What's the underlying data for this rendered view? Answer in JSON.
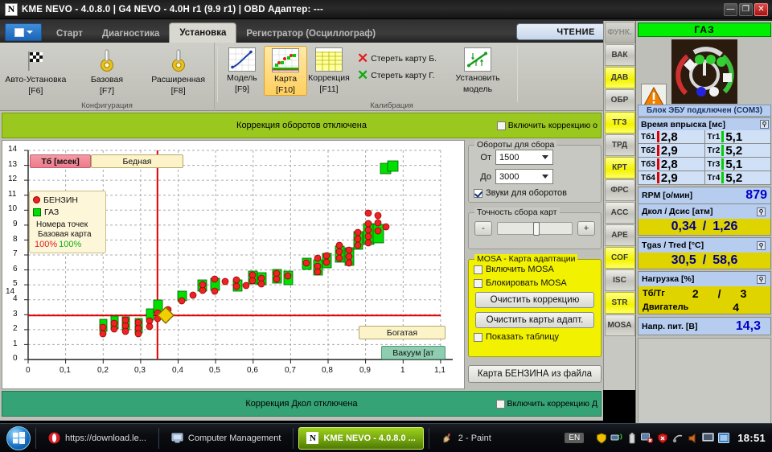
{
  "window": {
    "title": "KME NEVO - 4.0.8.0  |  G4 NEVO - 4.0H r1 (9.9 r1)  |  OBD Адаптер: ---",
    "icon_letter": "N",
    "minimize": "—",
    "maximize": "❐",
    "close": "✕"
  },
  "tabs": [
    {
      "label": "Старт",
      "active": false
    },
    {
      "label": "Диагностика",
      "active": false
    },
    {
      "label": "Установка",
      "active": true
    },
    {
      "label": "Регистратор (Осциллограф)",
      "active": false
    }
  ],
  "read_button": "ЧТЕНИЕ",
  "ribbon": {
    "groups": [
      {
        "label": "Конфигурация",
        "items": [
          {
            "name": "auto-setup",
            "line1": "Авто-Установка",
            "line2": "[F6]",
            "icon": "checkered-flag-icon",
            "selected": false
          },
          {
            "name": "basic",
            "line1": "Базовая",
            "line2": "[F7]",
            "icon": "gear-pin-icon",
            "selected": false
          },
          {
            "name": "advanced",
            "line1": "Расширенная",
            "line2": "[F8]",
            "icon": "gear-pin-icon",
            "selected": false
          }
        ]
      },
      {
        "label": "Калибрация",
        "items": [
          {
            "name": "model",
            "line1": "Модель",
            "line2": "[F9]",
            "icon": "curve-chart-icon",
            "selected": false
          },
          {
            "name": "map",
            "line1": "Карта",
            "line2": "[F10]",
            "icon": "scatter-map-icon",
            "selected": true
          },
          {
            "name": "correction",
            "line1": "Коррекция",
            "line2": "[F11]",
            "icon": "table-grid-icon",
            "selected": false
          }
        ],
        "erase": [
          {
            "label": "Стереть карту Б.",
            "color": "#e02020"
          },
          {
            "label": "Стереть карту Г.",
            "color": "#12aa12"
          }
        ],
        "set_model": {
          "line1": "Установить",
          "line2": "модель",
          "icon": "set-model-icon"
        }
      }
    ]
  },
  "vertical_tabs": [
    {
      "label": "ФУНК.",
      "state": "dim"
    },
    {
      "label": "ВАК",
      "state": "normal"
    },
    {
      "label": "ДАВ",
      "state": "hot"
    },
    {
      "label": "ОБР",
      "state": "normal"
    },
    {
      "label": "ТГЗ",
      "state": "hot"
    },
    {
      "label": "ТРД",
      "state": "normal"
    },
    {
      "label": "КРТ",
      "state": "hot"
    },
    {
      "label": "ФРС",
      "state": "normal"
    },
    {
      "label": "ACC",
      "state": "normal"
    },
    {
      "label": "APE",
      "state": "normal"
    },
    {
      "label": "COF",
      "state": "hot"
    },
    {
      "label": "ISC",
      "state": "normal"
    },
    {
      "label": "STR",
      "state": "hot"
    },
    {
      "label": "MOSA",
      "state": "normal"
    }
  ],
  "right_panel": {
    "fuel_tag": "ГАЗ",
    "connection": "Блок ЭБУ подключен (COM3)",
    "injection": {
      "title": "Время впрыска [мс]",
      "pin": "⚲",
      "rows": [
        {
          "pl": "Тб1",
          "pv": "2,8",
          "gl": "Tг1",
          "gv": "5,1"
        },
        {
          "pl": "Тб2",
          "pv": "2,9",
          "gl": "Tг2",
          "gv": "5,2"
        },
        {
          "pl": "Тб3",
          "pv": "2,8",
          "gl": "Tг3",
          "gv": "5,1"
        },
        {
          "pl": "Тб4",
          "pv": "2,9",
          "gl": "Tг4",
          "gv": "5,2"
        }
      ]
    },
    "rpm": {
      "label": "RPM [о/мин]",
      "value": "879"
    },
    "pressure": {
      "label": "Дкол / Дсис [атм]",
      "v1": "0,34",
      "sep": "/",
      "v2": "1,26",
      "pin": "⚲"
    },
    "temps": {
      "label": "Tgas / Tred [°C]",
      "v1": "30,5",
      "sep": "/",
      "v2": "58,6",
      "pin": "⚲"
    },
    "load": {
      "label": "Нагрузка [%]",
      "pin": "⚲",
      "row1_label": "Тб/Тг",
      "row1_v1": "2",
      "row1_sep": "/",
      "row1_v2": "3",
      "row2_label": "Двигатель",
      "row2_v": "4"
    },
    "voltage": {
      "label": "Напр. пит. [В]",
      "value": "14,3"
    }
  },
  "plot_banners": {
    "top": {
      "text": "Коррекция оборотов отключена",
      "checkbox_label": "Включить коррекцию о",
      "checked": false
    },
    "bottom": {
      "text": "Коррекция Дкол отключена",
      "checkbox_label": "Включить коррекцию Д",
      "checked": false
    }
  },
  "chart_data": {
    "type": "scatter",
    "title": "",
    "xlabel": "Вакуум [ат",
    "ylabel": "Тб [мсек]",
    "xlim": [
      0,
      1.1
    ],
    "ylim": [
      0,
      14
    ],
    "xticks": [
      "0",
      "0,1",
      "0,2",
      "0,3",
      "0,4",
      "0,5",
      "0,6",
      "0,7",
      "0,8",
      "0,9",
      "1",
      "1,1"
    ],
    "yticks": [
      "0",
      "1",
      "2",
      "3",
      "4",
      "5",
      "6",
      "7",
      "8",
      "9",
      "10",
      "11",
      "12",
      "13",
      "14"
    ],
    "grid": true,
    "annotations": [
      {
        "text": "Бедная",
        "position": "top-left"
      },
      {
        "text": "Богатая",
        "position": "bottom-right"
      }
    ],
    "crosshair": {
      "x": 0.345,
      "y": 2.95
    },
    "cursor_marker": {
      "x": 0.355,
      "y": 2.9,
      "shape": "diamond",
      "color": "#f0d000"
    },
    "legend": {
      "entries": [
        {
          "label": "БЕНЗИН",
          "color": "#ee2222",
          "marker": "circle"
        },
        {
          "label": "ГАЗ",
          "color": "#00e000",
          "marker": "square"
        }
      ],
      "note_line1": "Номера точек",
      "note_line2": "Базовая карта",
      "pct_petrol": "100%",
      "pct_gas": "100%"
    },
    "series": [
      {
        "name": "ГАЗ",
        "color": "#00e000",
        "marker": "square",
        "points": [
          {
            "x": 0.205,
            "y": 2.2
          },
          {
            "x": 0.235,
            "y": 2.3
          },
          {
            "x": 0.265,
            "y": 2.25
          },
          {
            "x": 0.3,
            "y": 2.2
          },
          {
            "x": 0.325,
            "y": 2.75
          },
          {
            "x": 0.345,
            "y": 3.2
          },
          {
            "x": 0.41,
            "y": 3.7
          },
          {
            "x": 0.465,
            "y": 4.4
          },
          {
            "x": 0.5,
            "y": 4.5
          },
          {
            "x": 0.56,
            "y": 4.4
          },
          {
            "x": 0.6,
            "y": 4.9
          },
          {
            "x": 0.625,
            "y": 4.8
          },
          {
            "x": 0.665,
            "y": 5.0
          },
          {
            "x": 0.695,
            "y": 4.9
          },
          {
            "x": 0.745,
            "y": 5.7
          },
          {
            "x": 0.775,
            "y": 5.6
          },
          {
            "x": 0.8,
            "y": 6.0
          },
          {
            "x": 0.835,
            "y": 6.4
          },
          {
            "x": 0.86,
            "y": 6.3
          },
          {
            "x": 0.885,
            "y": 7.4
          },
          {
            "x": 0.91,
            "y": 7.9
          },
          {
            "x": 0.935,
            "y": 7.9
          },
          {
            "x": 0.955,
            "y": 12.8
          },
          {
            "x": 0.975,
            "y": 12.9
          }
        ]
      },
      {
        "name": "БЕНЗИН",
        "color": "#ee2222",
        "marker": "circle",
        "points": [
          {
            "x": 0.205,
            "y": 2.0
          },
          {
            "x": 0.235,
            "y": 2.2
          },
          {
            "x": 0.265,
            "y": 2.5
          },
          {
            "x": 0.3,
            "y": 2.4
          },
          {
            "x": 0.325,
            "y": 2.6
          },
          {
            "x": 0.355,
            "y": 3.0
          },
          {
            "x": 0.375,
            "y": 3.1
          },
          {
            "x": 0.41,
            "y": 3.5
          },
          {
            "x": 0.44,
            "y": 4.2
          },
          {
            "x": 0.47,
            "y": 4.3
          },
          {
            "x": 0.5,
            "y": 4.6
          },
          {
            "x": 0.525,
            "y": 4.3
          },
          {
            "x": 0.555,
            "y": 4.5
          },
          {
            "x": 0.585,
            "y": 4.3
          },
          {
            "x": 0.6,
            "y": 4.9
          },
          {
            "x": 0.63,
            "y": 4.9
          },
          {
            "x": 0.665,
            "y": 5.1
          },
          {
            "x": 0.695,
            "y": 5.0
          },
          {
            "x": 0.745,
            "y": 5.7
          },
          {
            "x": 0.775,
            "y": 5.6
          },
          {
            "x": 0.8,
            "y": 6.0
          },
          {
            "x": 0.835,
            "y": 6.6
          },
          {
            "x": 0.86,
            "y": 6.5
          },
          {
            "x": 0.885,
            "y": 7.5
          },
          {
            "x": 0.91,
            "y": 8.0
          },
          {
            "x": 0.93,
            "y": 7.7
          }
        ]
      }
    ]
  },
  "settings": {
    "rpm_group": {
      "title": "Обороты для сбора",
      "from_label": "От",
      "from_value": "1500",
      "to_label": "До",
      "to_value": "3000",
      "sound_label": "Звуки для оборотов",
      "sound_checked": true
    },
    "accuracy_group": {
      "title": "Точность сбора карт",
      "minus": "-",
      "plus": "+"
    },
    "mosa_group": {
      "title": "MOSA - Карта адаптации",
      "enable_label": "Включить MOSA",
      "enable_checked": false,
      "block_label": "Блокировать MOSA",
      "block_checked": false,
      "clear_correction": "Очистить коррекцию",
      "clear_maps": "Очистить карты адапт.",
      "show_table_label": "Показать таблицу",
      "show_table_checked": false
    },
    "petrol_from_file": "Карта БЕНЗИНА из файла"
  },
  "taskbar": {
    "items": [
      {
        "label": "https://download.le...",
        "icon": "opera-icon",
        "active": false
      },
      {
        "label": "Computer Management",
        "icon": "computer-icon",
        "active": false
      },
      {
        "label": "KME NEVO - 4.0.8.0 ...",
        "icon": "nevo-icon",
        "active": true
      },
      {
        "label": "2 - Paint",
        "icon": "paint-icon",
        "active": false
      }
    ],
    "language": "EN",
    "clock": "18:51",
    "tray_icons": [
      "shield-yellow-icon",
      "network-icon",
      "battery-icon",
      "display-error-icon",
      "security-alert-icon",
      "sound-icon",
      "speaker-icon",
      "monitor-icon",
      "window-icon"
    ]
  }
}
